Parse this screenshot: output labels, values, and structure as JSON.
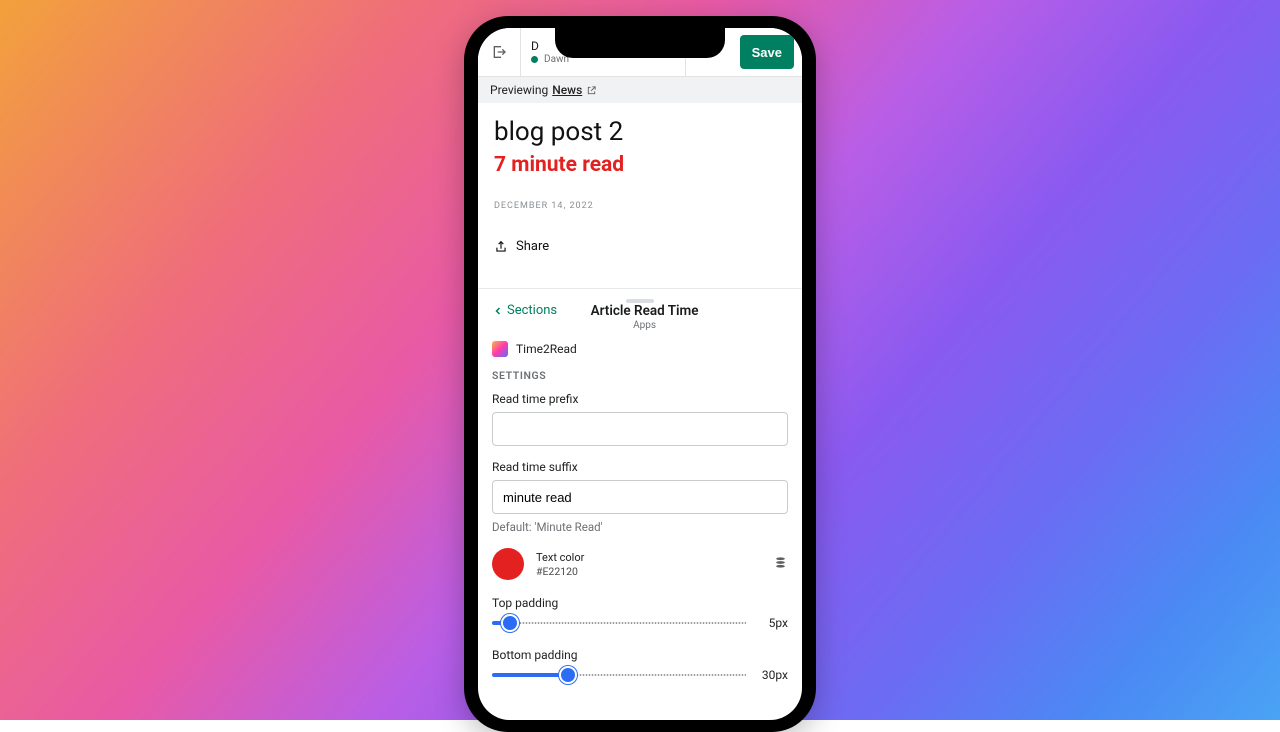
{
  "topbar": {
    "file_initial": "D",
    "theme_name": "Dawn",
    "save_label": "Save"
  },
  "preview_strip": {
    "prefix": "Previewing ",
    "link_label": "News"
  },
  "article": {
    "title": "blog post 2",
    "read_time": "7 minute read",
    "date": "DECEMBER 14, 2022",
    "share_label": "Share"
  },
  "panel": {
    "back_label": "Sections",
    "title": "Article Read Time",
    "subtitle": "Apps",
    "app_name": "Time2Read",
    "settings_heading": "SETTINGS",
    "prefix": {
      "label": "Read time prefix",
      "value": ""
    },
    "suffix": {
      "label": "Read time suffix",
      "value": "minute read",
      "hint": "Default: 'Minute Read'"
    },
    "text_color": {
      "label": "Text color",
      "hex": "#E22120"
    },
    "top_padding": {
      "label": "Top padding",
      "display": "5px",
      "percent": 7
    },
    "bottom_padding": {
      "label": "Bottom padding",
      "display": "30px",
      "percent": 30
    }
  }
}
